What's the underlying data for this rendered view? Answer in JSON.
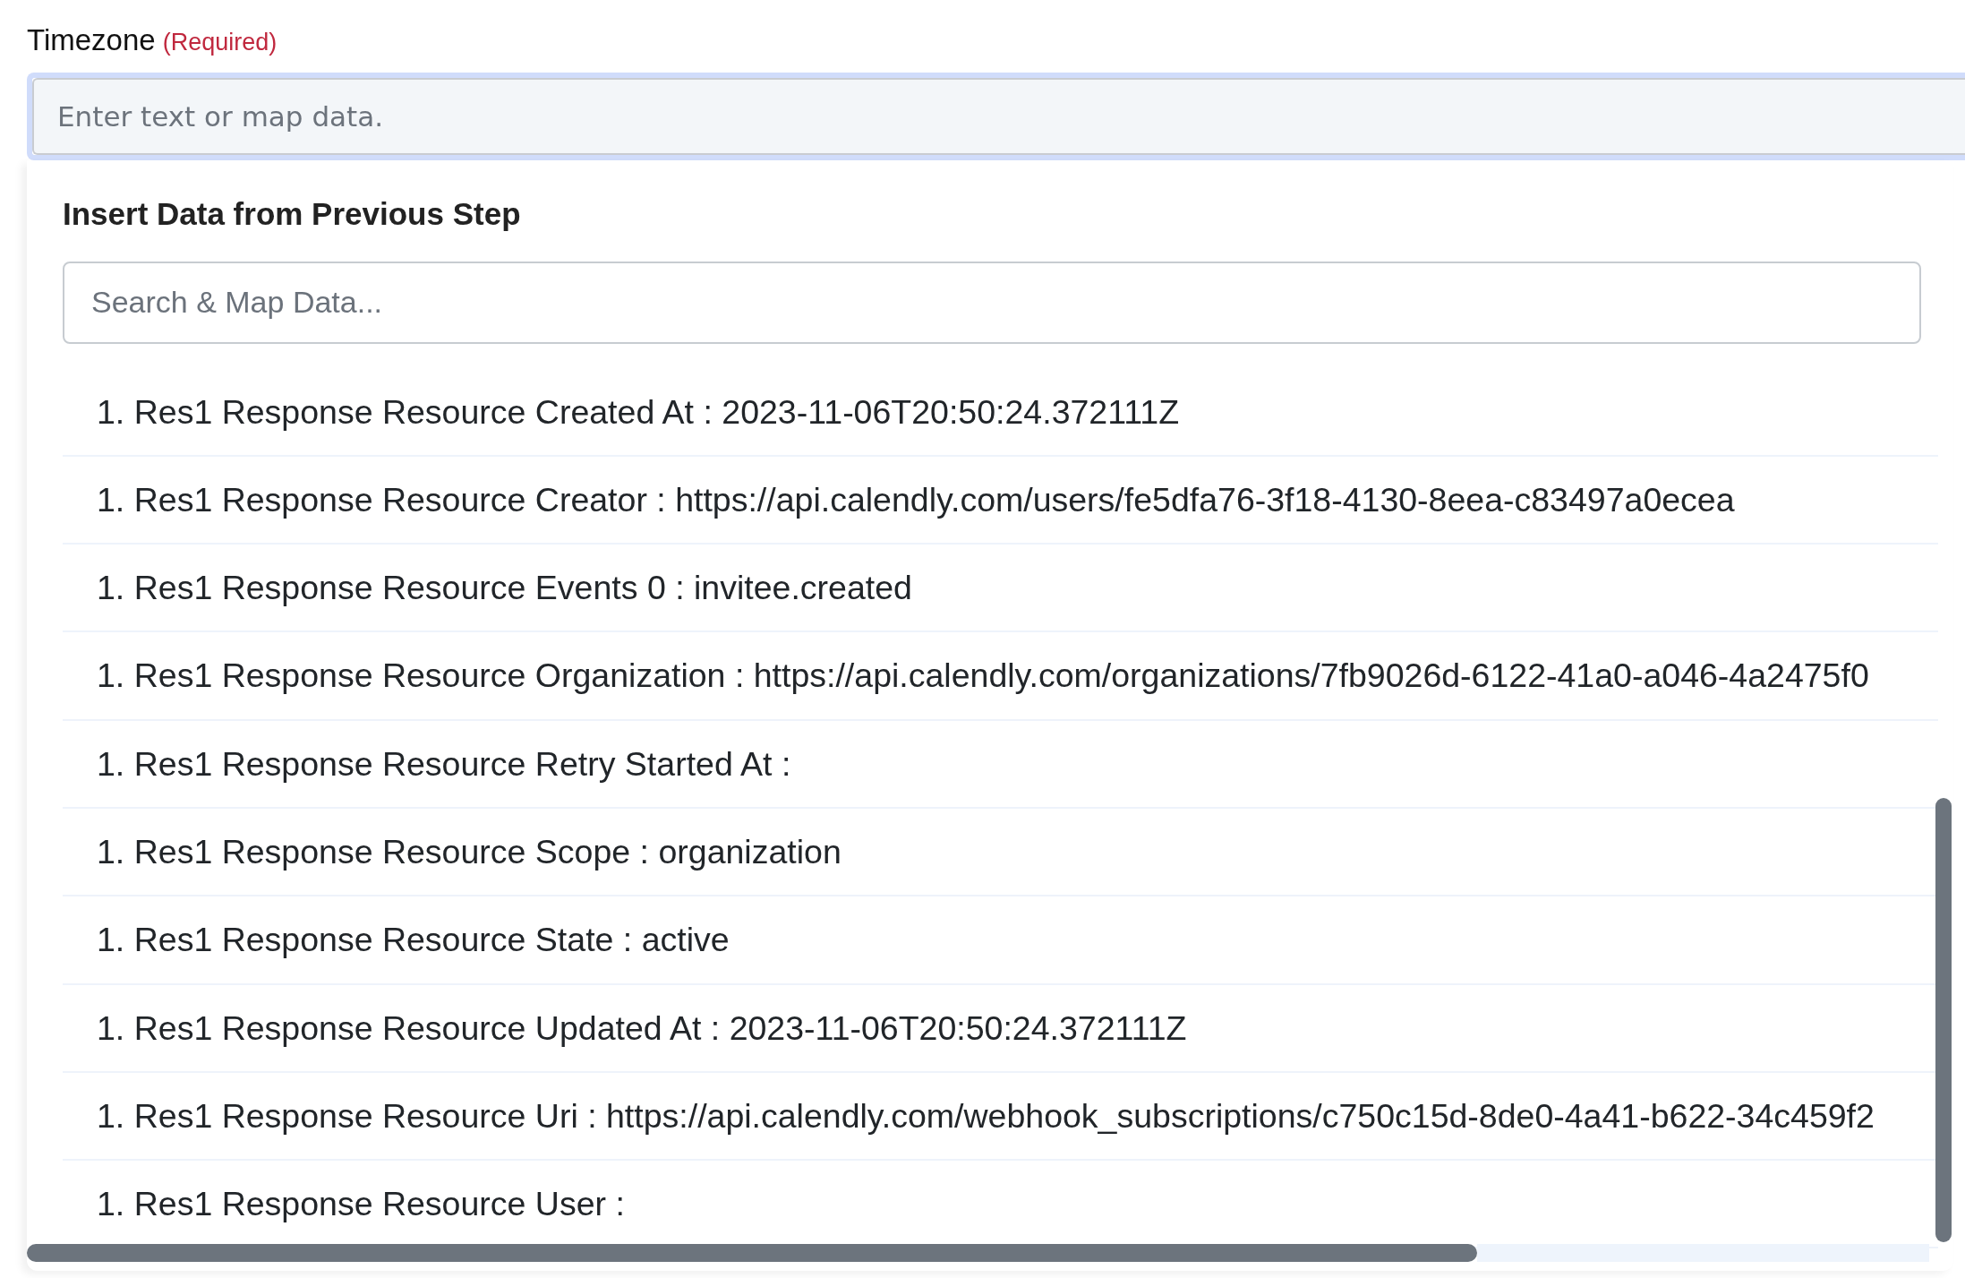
{
  "field": {
    "label": "Timezone",
    "required_note": "(Required)",
    "placeholder": "Enter text or map data."
  },
  "dropdown": {
    "title": "Insert Data from Previous Step",
    "search": {
      "placeholder": "Search & Map Data..."
    },
    "items": [
      {
        "text": "1. Res1 Response Resource Created At : 2023-11-06T20:50:24.372111Z"
      },
      {
        "text": "1. Res1 Response Resource Creator : https://api.calendly.com/users/fe5dfa76-3f18-4130-8eea-c83497a0ecea"
      },
      {
        "text": "1. Res1 Response Resource Events 0 : invitee.created"
      },
      {
        "text": "1. Res1 Response Resource Organization : https://api.calendly.com/organizations/7fb9026d-6122-41a0-a046-4a2475f0"
      },
      {
        "text": "1. Res1 Response Resource Retry Started At :"
      },
      {
        "text": "1. Res1 Response Resource Scope : organization"
      },
      {
        "text": "1. Res1 Response Resource State : active"
      },
      {
        "text": "1. Res1 Response Resource Updated At : 2023-11-06T20:50:24.372111Z"
      },
      {
        "text": "1. Res1 Response Resource Uri : https://api.calendly.com/webhook_subscriptions/c750c15d-8de0-4a41-b622-34c459f2"
      },
      {
        "text": "1. Res1 Response Resource User :"
      }
    ]
  }
}
